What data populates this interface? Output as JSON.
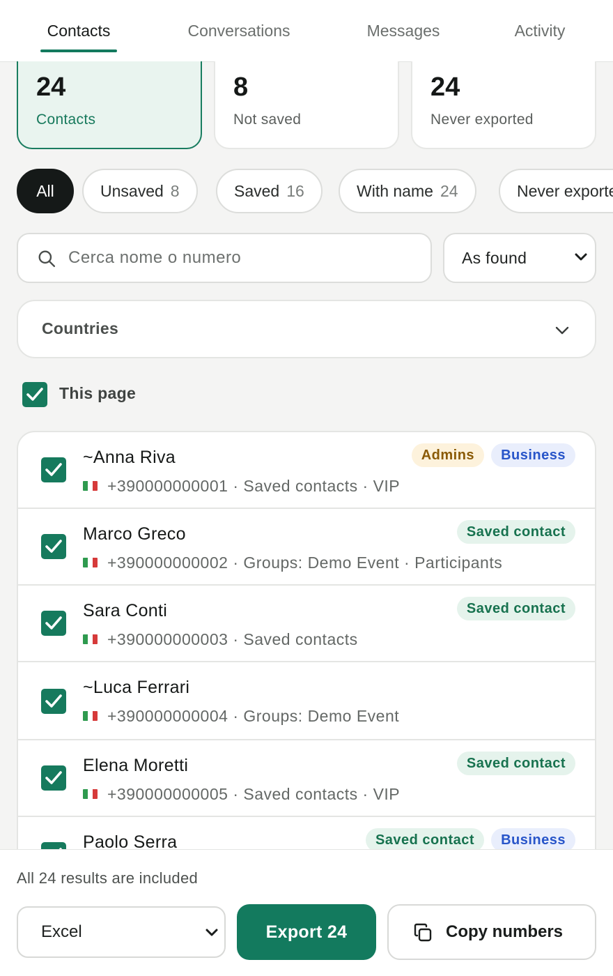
{
  "tabs": [
    {
      "label": "Contacts",
      "active": true
    },
    {
      "label": "Conversations",
      "active": false
    },
    {
      "label": "Messages",
      "active": false
    },
    {
      "label": "Activity",
      "active": false
    }
  ],
  "stats": [
    {
      "value": "24",
      "label": "Contacts"
    },
    {
      "value": "8",
      "label": "Not saved"
    },
    {
      "value": "24",
      "label": "Never exported"
    }
  ],
  "filters": [
    {
      "label": "All",
      "count": ""
    },
    {
      "label": "Unsaved",
      "count": "8"
    },
    {
      "label": "Saved",
      "count": "16"
    },
    {
      "label": "With name",
      "count": "24"
    },
    {
      "label": "Never exported",
      "count": ""
    }
  ],
  "search": {
    "placeholder": "Cerca nome o numero",
    "value": ""
  },
  "sort": {
    "selected": "As found"
  },
  "countries": {
    "label": "Countries"
  },
  "select_page": {
    "label": "This page",
    "checked": true
  },
  "contacts": [
    {
      "name": "~Anna Riva",
      "meta": "+390000000001 · Saved contacts · VIP",
      "badges": [
        {
          "text": "Admins",
          "kind": "admins"
        },
        {
          "text": "Business",
          "kind": "business"
        }
      ]
    },
    {
      "name": "Marco Greco",
      "meta": "+390000000002 · Groups: Demo Event · Participants",
      "badges": [
        {
          "text": "Saved contact",
          "kind": "saved"
        }
      ]
    },
    {
      "name": "Sara Conti",
      "meta": "+390000000003 · Saved contacts",
      "badges": [
        {
          "text": "Saved contact",
          "kind": "saved"
        }
      ]
    },
    {
      "name": "~Luca Ferrari",
      "meta": "+390000000004 · Groups: Demo Event",
      "badges": []
    },
    {
      "name": "Elena Moretti",
      "meta": "+390000000005 · Saved contacts · VIP",
      "badges": [
        {
          "text": "Saved contact",
          "kind": "saved"
        }
      ]
    },
    {
      "name": "Paolo Serra",
      "meta": "",
      "badges": [
        {
          "text": "Saved contact",
          "kind": "saved"
        },
        {
          "text": "Business",
          "kind": "business"
        }
      ]
    }
  ],
  "footer": {
    "note": "All 24 results are included",
    "format": "Excel",
    "export_label": "Export 24",
    "copy_label": "Copy numbers"
  },
  "colors": {
    "accent": "#137a5e",
    "flag_green": "#2f9a4f",
    "flag_white": "#ffffff",
    "flag_red": "#d63a3a"
  }
}
